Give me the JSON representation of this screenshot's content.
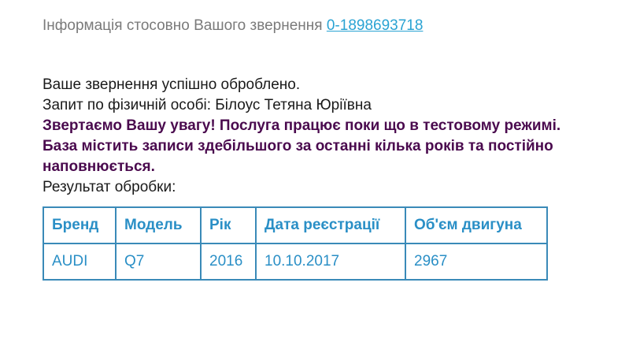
{
  "header": {
    "text": "Інформація стосовно Вашого звернення ",
    "request_number": "0-1898693718"
  },
  "body": {
    "line1": "Ваше звернення успішно оброблено.",
    "line2": "Запит по фізичній особі: Білоус Тетяна Юріївна",
    "notice": "Звертаємо Вашу увагу! Послуга працює поки що в тестовому режимі. База містить записи здебільшого за останні кілька років та постійно наповнюється.",
    "result_label": "Результат обробки:"
  },
  "table": {
    "headers": {
      "brand": "Бренд",
      "model": "Модель",
      "year": "Рік",
      "reg_date": "Дата реєстрації",
      "engine": "Об'єм двигуна"
    },
    "rows": [
      {
        "brand": "AUDI",
        "model": "Q7",
        "year": "2016",
        "reg_date": "10.10.2017",
        "engine": "2967"
      }
    ]
  },
  "colors": {
    "link": "#2aa3d3",
    "notice": "#4a0a4e",
    "table_text": "#2a8fc6",
    "table_border": "#3a8ab8",
    "header_text": "#7a7a7a"
  }
}
